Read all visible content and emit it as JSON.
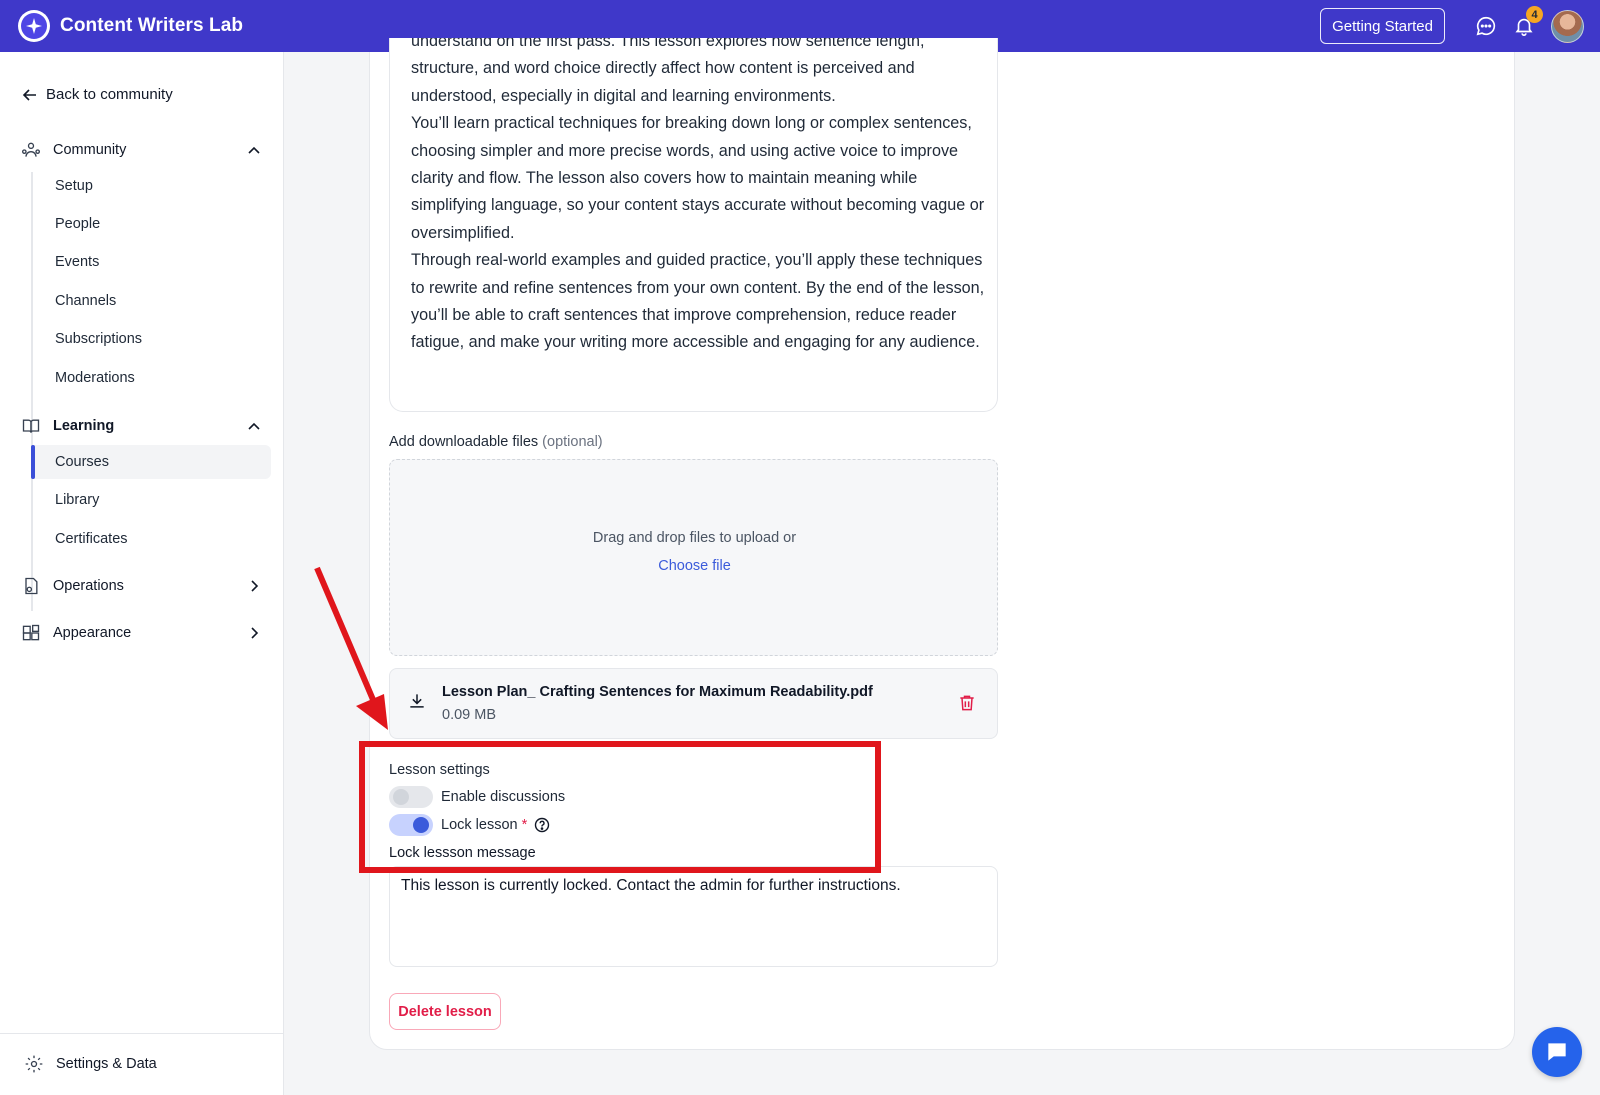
{
  "header": {
    "title": "Content Writers Lab",
    "getting_started": "Getting Started",
    "notification_count": "4",
    "accent": "#3f38c9"
  },
  "sidebar": {
    "back": "Back to community",
    "community": {
      "label": "Community",
      "items": [
        "Setup",
        "People",
        "Events",
        "Channels",
        "Subscriptions",
        "Moderations"
      ]
    },
    "learning": {
      "label": "Learning",
      "items": [
        "Courses",
        "Library",
        "Certificates"
      ],
      "active": "Courses"
    },
    "operations": "Operations",
    "appearance": "Appearance",
    "settings": "Settings & Data"
  },
  "lesson": {
    "description_paragraphs": [
      "understand on the first pass. This lesson explores how sentence length, structure, and word choice directly affect how content is perceived and understood, especially in digital and learning environments.",
      "You’ll learn practical techniques for breaking down long or complex sentences, choosing simpler and more precise words, and using active voice to improve clarity and flow. The lesson also covers how to maintain meaning while simplifying language, so your content stays accurate without becoming vague or oversimplified.",
      "Through real-world examples and guided practice, you’ll apply these techniques to rewrite and refine sentences from your own content. By the end of the lesson, you’ll be able to craft sentences that improve comprehension, reduce reader fatigue, and make your writing more accessible and engaging for any audience."
    ],
    "files_label": "Add downloadable files",
    "files_optional": "(optional)",
    "dropzone_text": "Drag and drop files to upload or",
    "choose_file": "Choose file",
    "file": {
      "name": "Lesson Plan_ Crafting Sentences for Maximum Readability.pdf",
      "size": "0.09 MB"
    },
    "settings_label": "Lesson settings",
    "enable_discussions": {
      "label": "Enable discussions",
      "on": false
    },
    "lock_lesson": {
      "label": "Lock lesson",
      "required": "*",
      "on": true
    },
    "lock_message_label": "Lock lessson message",
    "lock_message_value": "This lesson is currently locked. Contact the admin for further instructions.",
    "delete": "Delete lesson"
  },
  "annotation_color": "#e0161c"
}
